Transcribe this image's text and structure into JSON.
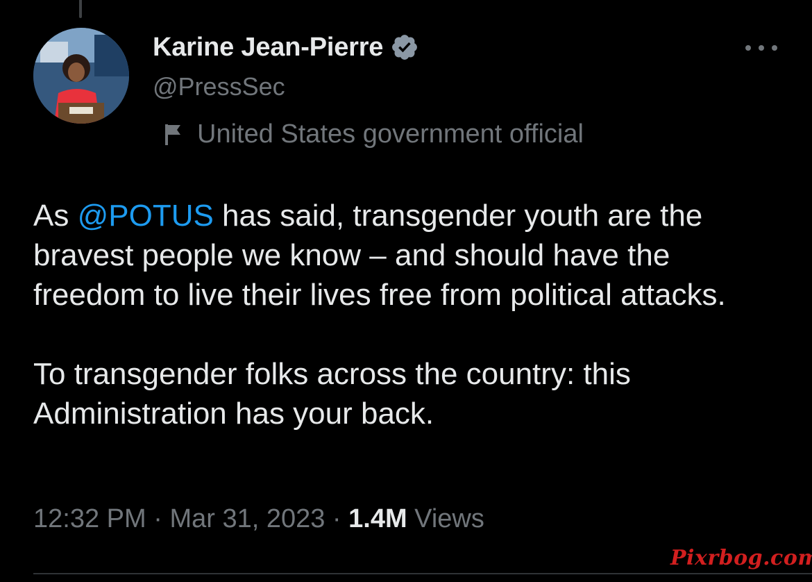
{
  "author": {
    "display_name": "Karine Jean-Pierre",
    "handle": "@PressSec",
    "verified_icon": "verified-badge-icon",
    "label_icon": "flag-icon",
    "label": "United States government official"
  },
  "tweet": {
    "paragraph1_prefix": "As ",
    "mention": "@POTUS",
    "paragraph1_rest": " has said, transgender youth are the bravest people we know – and should have the freedom to live their lives free from political attacks.",
    "paragraph2": "To transgender folks across the country: this Administration has your back."
  },
  "meta": {
    "time": "12:32 PM",
    "separator": " · ",
    "date": "Mar 31, 2023",
    "views_count": "1.4M",
    "views_label": " Views"
  },
  "watermark": "Pixrbog.com",
  "colors": {
    "background": "#000000",
    "text": "#e7e9ea",
    "secondary": "#71767b",
    "link": "#1d9bf0",
    "verified": "#8b98a5",
    "watermark": "#d21f1f"
  }
}
